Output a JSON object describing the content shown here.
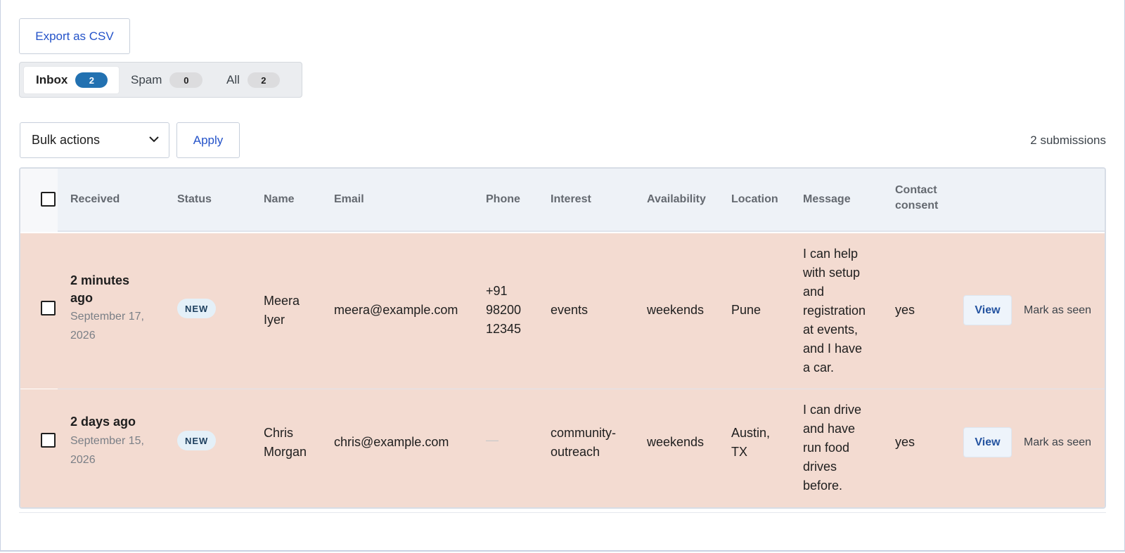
{
  "toolbar": {
    "export_label": "Export as CSV"
  },
  "tabs": [
    {
      "label": "Inbox",
      "count": "2",
      "active": true
    },
    {
      "label": "Spam",
      "count": "0",
      "active": false
    },
    {
      "label": "All",
      "count": "2",
      "active": false
    }
  ],
  "bulk": {
    "selected": "Bulk actions",
    "apply_label": "Apply"
  },
  "summary": {
    "count_text": "2 submissions"
  },
  "table": {
    "headers": {
      "received": "Received",
      "status": "Status",
      "name": "Name",
      "email": "Email",
      "phone": "Phone",
      "interest": "Interest",
      "availability": "Availability",
      "location": "Location",
      "message": "Message",
      "consent_1": "Contact",
      "consent_2": "consent"
    },
    "rows": [
      {
        "received_1": "2 minutes",
        "received_2": "ago",
        "date_1": "September 17,",
        "date_2": "2026",
        "status": "NEW",
        "name_1": "Meera",
        "name_2": "Iyer",
        "email": "meera@example.com",
        "phone_1": "+91",
        "phone_2": "98200",
        "phone_3": "12345",
        "interest": "events",
        "availability": "weekends",
        "location": "Pune",
        "message": [
          "I can help",
          "with setup",
          "and",
          "registration",
          "at events,",
          "and I have",
          "a car."
        ],
        "consent": "yes",
        "view_label": "View",
        "seen_label": "Mark as seen"
      },
      {
        "received_1": "2 days ago",
        "date_1": "September 15,",
        "date_2": "2026",
        "status": "NEW",
        "name_1": "Chris",
        "name_2": "Morgan",
        "email": "chris@example.com",
        "phone": "—",
        "interest_1": "community-",
        "interest_2": "outreach",
        "availability": "weekends",
        "location_1": "Austin,",
        "location_2": "TX",
        "message": [
          "I can drive",
          "and have",
          "run food",
          "drives",
          "before."
        ],
        "consent": "yes",
        "view_label": "View",
        "seen_label": "Mark as seen"
      }
    ]
  }
}
